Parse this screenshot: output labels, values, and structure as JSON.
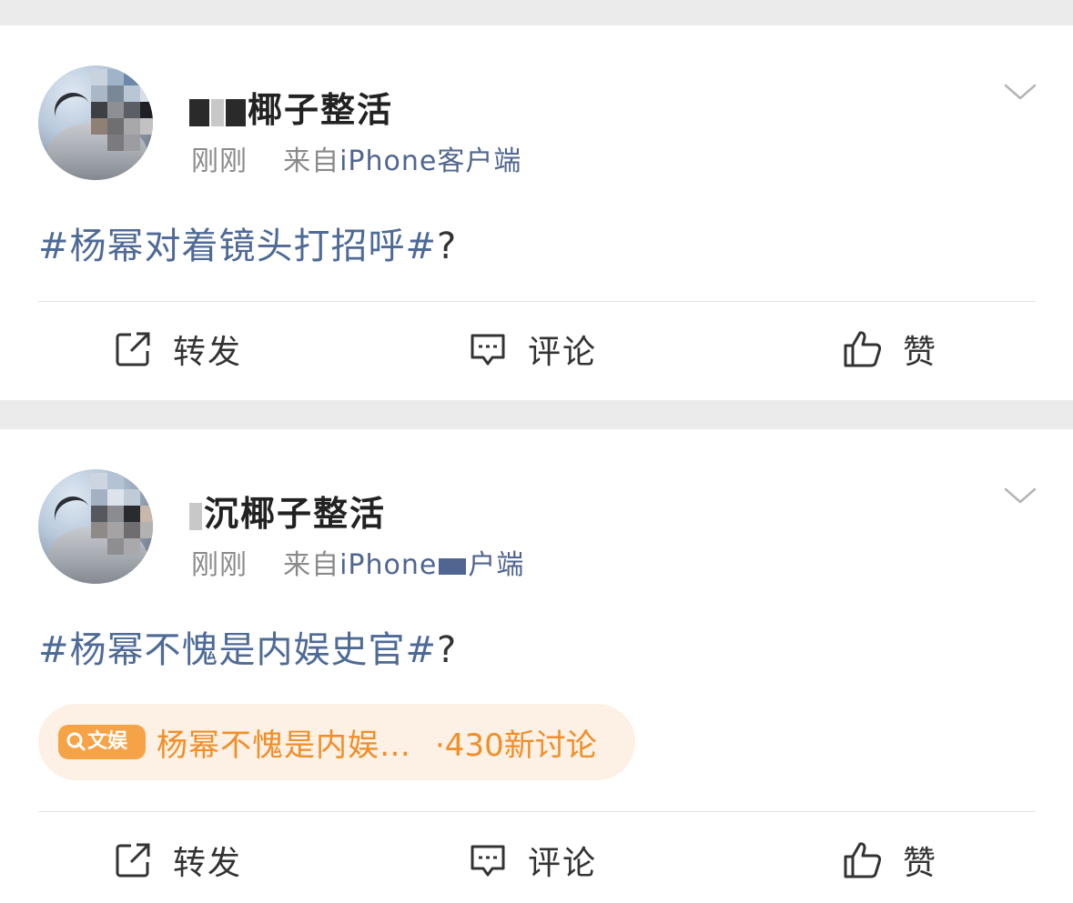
{
  "posts": [
    {
      "username": "椰子整活",
      "time": "刚刚",
      "source_prefix": "来自",
      "source_device": "iPhone",
      "source_suffix": "客户端",
      "hashtag": "#杨幂对着镜头打招呼#",
      "tail": "?",
      "actions": {
        "repost": "转发",
        "comment": "评论",
        "like": "赞"
      }
    },
    {
      "username": "沉椰子整活",
      "time": "刚刚",
      "source_prefix": "来自",
      "source_device": "iPhone",
      "source_suffix": "户端",
      "hashtag": "#杨幂不愧是内娱史官#",
      "tail": "?",
      "topic": {
        "badge": "文娱",
        "name": "杨幂不愧是内娱…",
        "count": "·430新讨论"
      },
      "actions": {
        "repost": "转发",
        "comment": "评论",
        "like": "赞"
      }
    }
  ],
  "icons": {
    "repost": "repost-icon",
    "comment": "comment-icon",
    "like": "thumbs-up-icon",
    "menu": "chevron-down-icon",
    "search": "search-icon"
  },
  "colors": {
    "hashtag": "#4e6a96",
    "source": "#506590",
    "meta": "#8a8a8a",
    "topic_text": "#f08e28",
    "topic_bg": "#fdf0e4",
    "badge_bg": "#f6a348",
    "background": "#ebebeb"
  }
}
